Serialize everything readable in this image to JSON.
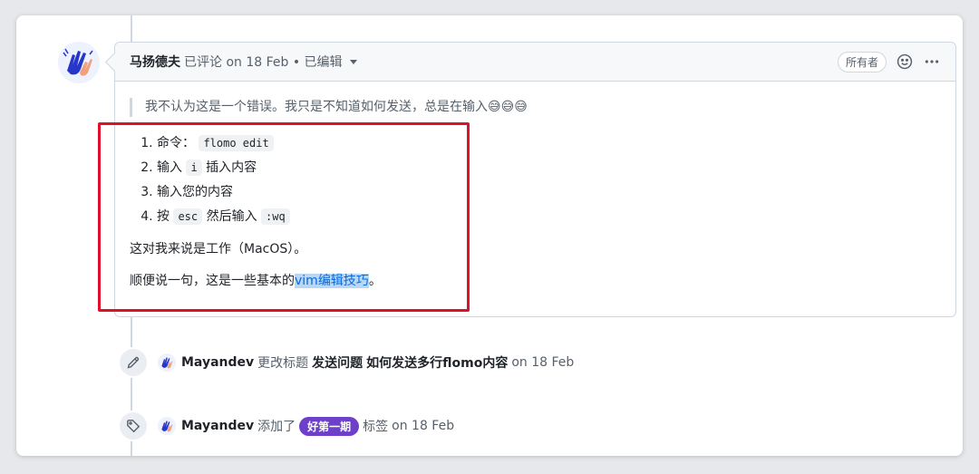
{
  "comment": {
    "author": "马扬德夫",
    "meta": "已评论 on 18 Feb • 已编辑",
    "owner_badge": "所有者",
    "quote": "我不认为这是一个错误。我只是不知道如何发送，总是在输入😅😅😅",
    "steps": [
      {
        "prefix": "命令：",
        "code": "flomo edit",
        "suffix": ""
      },
      {
        "prefix": "输入",
        "code": "i",
        "suffix": "插入内容"
      },
      {
        "prefix": "输入您的内容",
        "code": "",
        "suffix": ""
      },
      {
        "prefix": "按",
        "code": "esc",
        "suffix": "然后输入",
        "code2": ":wq"
      }
    ],
    "paragraph1": "这对我来说是工作（MacOS）。",
    "paragraph2_prefix": "顺便说一句，这是一些基本的",
    "paragraph2_link": "vim编辑技巧",
    "paragraph2_suffix": "。"
  },
  "events": [
    {
      "actor": "Mayandev",
      "action": "更改标题",
      "old_title": "发送问题",
      "new_title": "如何发送多行flomo内容",
      "time": "on 18 Feb",
      "icon": "pencil-icon"
    },
    {
      "actor": "Mayandev",
      "action": "添加了",
      "label": "好第一期",
      "after": "标签",
      "time": "on 18 Feb",
      "icon": "tag-icon"
    }
  ],
  "colors": {
    "label": "#6e40c9",
    "link": "#0969da",
    "annotation_box": "#e0102a"
  }
}
